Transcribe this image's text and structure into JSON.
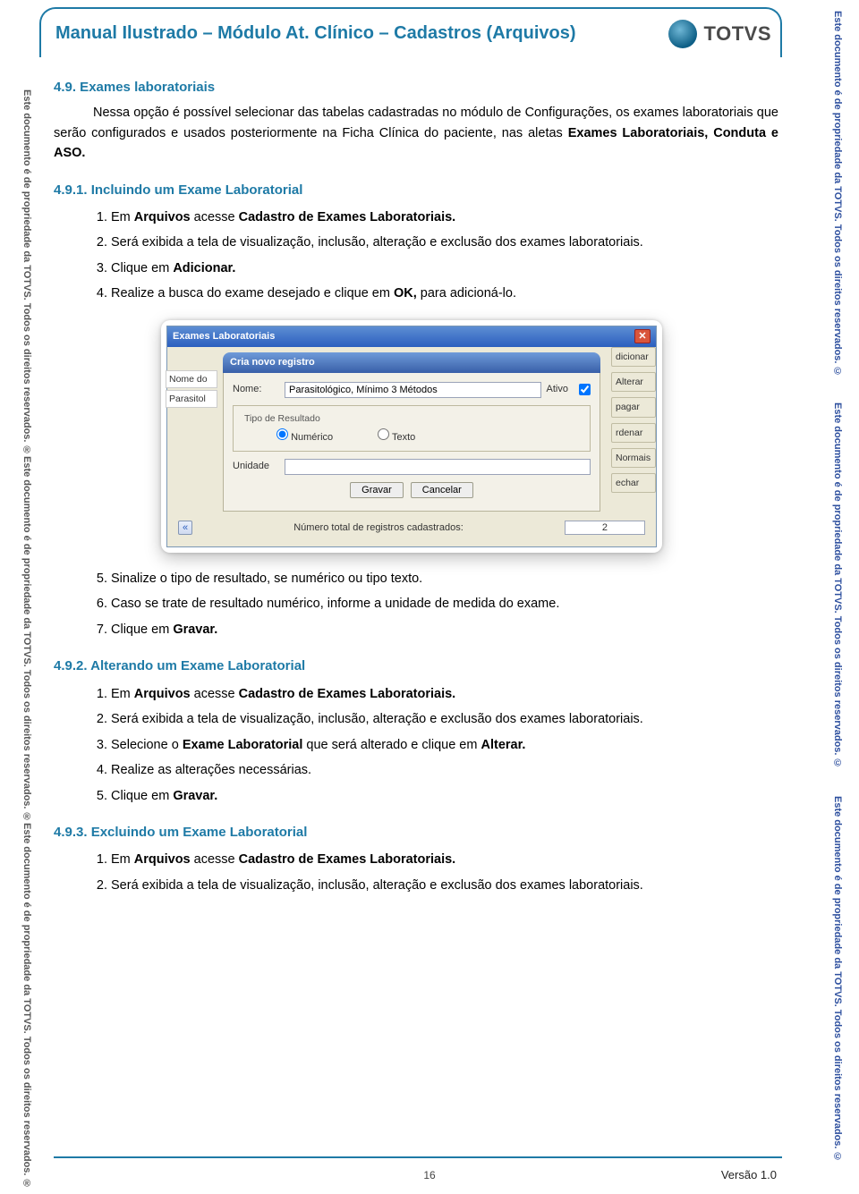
{
  "header": {
    "title": "Manual Ilustrado – Módulo At. Clínico – Cadastros (Arquivos)",
    "logo_text": "TOTVS"
  },
  "watermark_left": "Este documento é de propriedade da TOTVS. Todos os direitos reservados. ®",
  "watermark_right": "Este documento é de propriedade da TOTVS. Todos os direitos reservados. ©",
  "section49": {
    "heading": "4.9. Exames laboratoriais",
    "paragraph_parts": {
      "p1": "Nessa opção é possível selecionar das tabelas cadastradas no módulo de Configurações, os exames laboratoriais que serão configurados e usados posteriormente na Ficha Clínica do paciente, nas aletas ",
      "b1": "Exames Laboratoriais, Conduta e ASO.",
      "p2": ""
    }
  },
  "section491": {
    "heading": "4.9.1. Incluindo um Exame Laboratorial",
    "steps_a": [
      {
        "pre": "Em ",
        "b1": "Arquivos",
        "mid": " acesse ",
        "b2": "Cadastro de Exames Laboratoriais."
      },
      {
        "text": "Será exibida a tela de visualização, inclusão, alteração e exclusão dos exames laboratoriais."
      },
      {
        "pre": "Clique em ",
        "b1": "Adicionar."
      },
      {
        "pre": "Realize a busca do exame desejado e clique em ",
        "b1": "OK,",
        "post": " para adicioná-lo."
      }
    ],
    "steps_b_start": 5,
    "steps_b": [
      {
        "text": "Sinalize o tipo de resultado, se numérico ou tipo texto."
      },
      {
        "text": "Caso se trate de resultado numérico, informe a unidade de medida do exame."
      },
      {
        "pre": "Clique em ",
        "b1": "Gravar."
      }
    ]
  },
  "section492": {
    "heading": "4.9.2. Alterando um Exame Laboratorial",
    "steps": [
      {
        "pre": "Em ",
        "b1": "Arquivos",
        "mid": " acesse ",
        "b2": "Cadastro de Exames Laboratoriais."
      },
      {
        "text": "Será exibida a tela de visualização, inclusão, alteração e exclusão dos exames laboratoriais."
      },
      {
        "pre": "Selecione o ",
        "b1": "Exame Laboratorial",
        "mid": " que será alterado e clique em ",
        "b2": "Alterar."
      },
      {
        "text": "Realize as alterações necessárias."
      },
      {
        "pre": "Clique em ",
        "b1": "Gravar."
      }
    ]
  },
  "section493": {
    "heading": "4.9.3. Excluindo um Exame Laboratorial",
    "steps": [
      {
        "pre": "Em ",
        "b1": "Arquivos",
        "mid": " acesse ",
        "b2": "Cadastro de Exames Laboratoriais."
      },
      {
        "text": "Será exibida a tela de visualização, inclusão, alteração e exclusão dos exames laboratoriais."
      }
    ]
  },
  "screenshot": {
    "outer_title": "Exames Laboratoriais",
    "panel_title": "Cria novo registro",
    "left_header": "Nome do",
    "left_row": "Parasitol",
    "nome_label": "Nome:",
    "nome_value": "Parasitológico, Mínimo 3 Métodos",
    "ativo_label": "Ativo",
    "group_label": "Tipo de Resultado",
    "radio_numerico": "Numérico",
    "radio_texto": "Texto",
    "unidade_label": "Unidade",
    "unidade_value": "",
    "btn_gravar": "Gravar",
    "btn_cancelar": "Cancelar",
    "side": [
      "dicionar",
      "Alterar",
      "pagar",
      "rdenar",
      "Normais",
      "echar"
    ],
    "status_label": "Número total de registros cadastrados:",
    "count": "2"
  },
  "footer": {
    "page": "16",
    "version": "Versão 1.0"
  }
}
